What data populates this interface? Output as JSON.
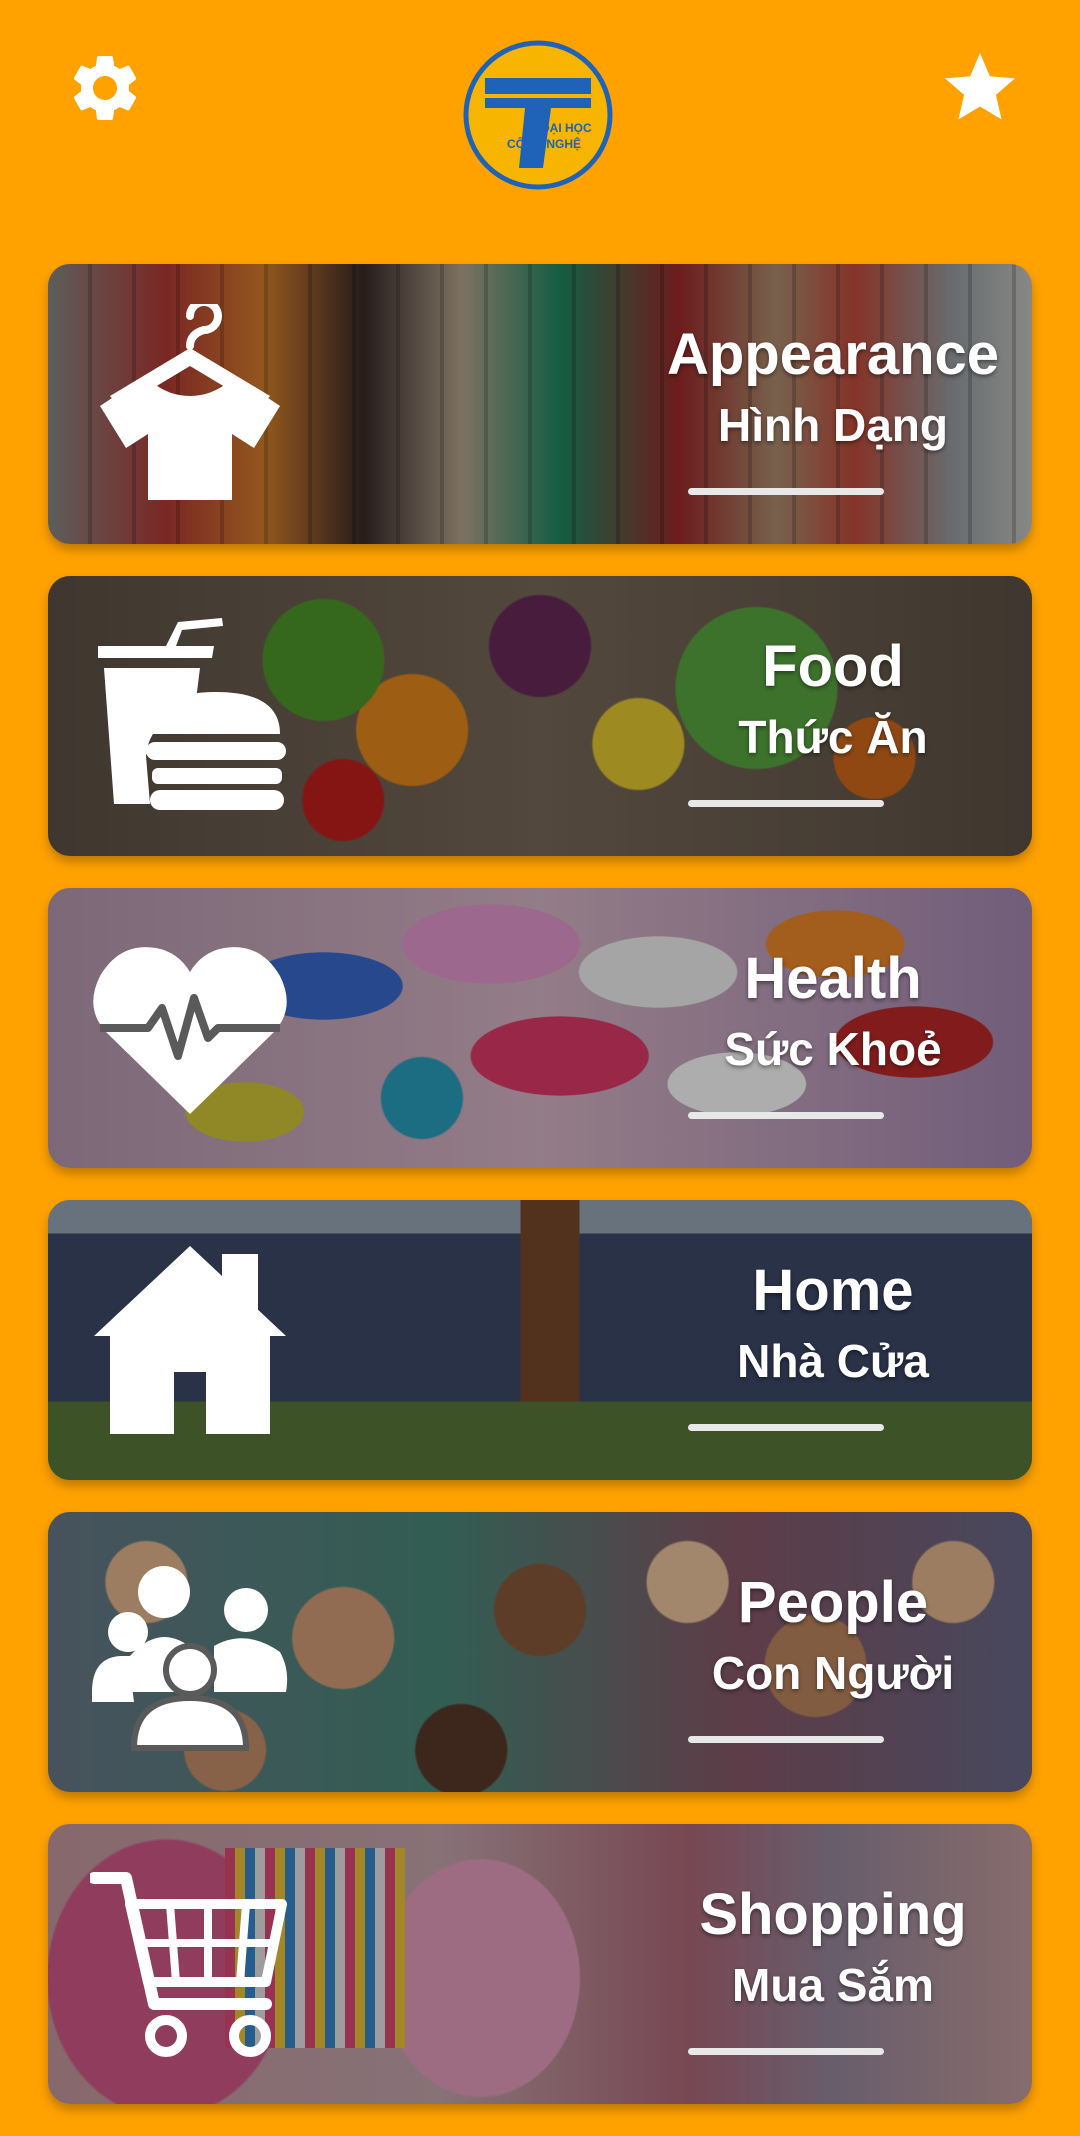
{
  "header": {
    "settings_icon": "gear-icon",
    "favorite_icon": "star-icon",
    "logo_text_line1": "ĐẠI HỌC",
    "logo_text_line2": "CÔNG NGHỆ"
  },
  "colors": {
    "background": "#FFA200",
    "logo_blue": "#1E63B8",
    "logo_yellow": "#F7B500",
    "text": "#FFFFFF"
  },
  "categories": [
    {
      "en": "Appearance",
      "vi": "Hình Dạng",
      "icon": "clothes-hanger-shirt-icon"
    },
    {
      "en": "Food",
      "vi": "Thức Ăn",
      "icon": "fast-food-icon"
    },
    {
      "en": "Health",
      "vi": "Sức Khoẻ",
      "icon": "heart-pulse-icon"
    },
    {
      "en": "Home",
      "vi": "Nhà Cửa",
      "icon": "house-icon"
    },
    {
      "en": "People",
      "vi": "Con Người",
      "icon": "group-people-icon"
    },
    {
      "en": "Shopping",
      "vi": "Mua Sắm",
      "icon": "shopping-cart-icon"
    }
  ]
}
